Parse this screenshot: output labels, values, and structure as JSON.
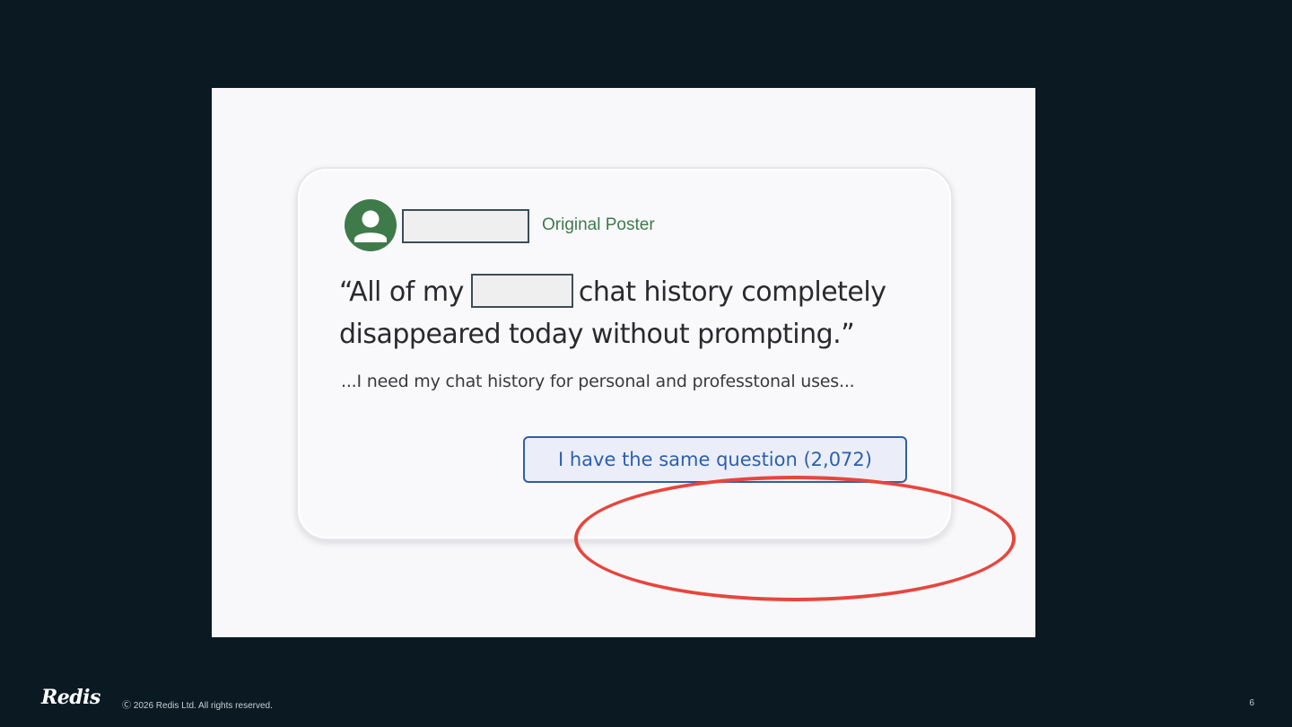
{
  "post": {
    "op_label": "Original Poster",
    "quote_line1_before": "“All of my",
    "quote_line1_after": "chat history completely",
    "quote_line2": "disappeared today without prompting.”",
    "subtext": "...I need my chat history for personal and professtonal uses...",
    "same_question_button": "I have the same question (2,072)"
  },
  "footer": {
    "logo": "Redis",
    "copyright": "Ⓒ 2026 Redis Ltd. All rights reserved.",
    "page_number": "6"
  },
  "colors": {
    "background": "#0b1923",
    "op_green": "#3f7a4a",
    "button_blue": "#2d5fae",
    "highlight_red": "#e8453c"
  },
  "icons": {
    "avatar": "user-avatar-icon"
  }
}
